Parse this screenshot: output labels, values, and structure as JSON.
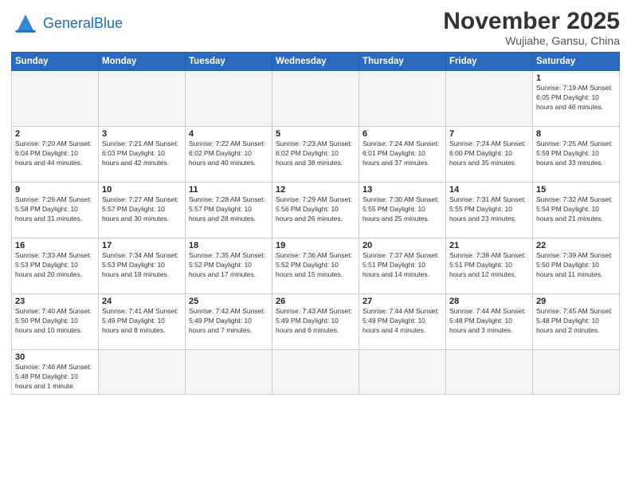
{
  "header": {
    "logo_general": "General",
    "logo_blue": "Blue",
    "month_title": "November 2025",
    "location": "Wujiahe, Gansu, China"
  },
  "weekdays": [
    "Sunday",
    "Monday",
    "Tuesday",
    "Wednesday",
    "Thursday",
    "Friday",
    "Saturday"
  ],
  "weeks": [
    [
      {
        "day": "",
        "info": "",
        "empty": true
      },
      {
        "day": "",
        "info": "",
        "empty": true
      },
      {
        "day": "",
        "info": "",
        "empty": true
      },
      {
        "day": "",
        "info": "",
        "empty": true
      },
      {
        "day": "",
        "info": "",
        "empty": true
      },
      {
        "day": "",
        "info": "",
        "empty": true
      },
      {
        "day": "1",
        "info": "Sunrise: 7:19 AM\nSunset: 6:05 PM\nDaylight: 10 hours\nand 46 minutes."
      }
    ],
    [
      {
        "day": "2",
        "info": "Sunrise: 7:20 AM\nSunset: 6:04 PM\nDaylight: 10 hours\nand 44 minutes."
      },
      {
        "day": "3",
        "info": "Sunrise: 7:21 AM\nSunset: 6:03 PM\nDaylight: 10 hours\nand 42 minutes."
      },
      {
        "day": "4",
        "info": "Sunrise: 7:22 AM\nSunset: 6:02 PM\nDaylight: 10 hours\nand 40 minutes."
      },
      {
        "day": "5",
        "info": "Sunrise: 7:23 AM\nSunset: 6:02 PM\nDaylight: 10 hours\nand 38 minutes."
      },
      {
        "day": "6",
        "info": "Sunrise: 7:24 AM\nSunset: 6:01 PM\nDaylight: 10 hours\nand 37 minutes."
      },
      {
        "day": "7",
        "info": "Sunrise: 7:24 AM\nSunset: 6:00 PM\nDaylight: 10 hours\nand 35 minutes."
      },
      {
        "day": "8",
        "info": "Sunrise: 7:25 AM\nSunset: 5:59 PM\nDaylight: 10 hours\nand 33 minutes."
      }
    ],
    [
      {
        "day": "9",
        "info": "Sunrise: 7:26 AM\nSunset: 5:58 PM\nDaylight: 10 hours\nand 31 minutes."
      },
      {
        "day": "10",
        "info": "Sunrise: 7:27 AM\nSunset: 5:57 PM\nDaylight: 10 hours\nand 30 minutes."
      },
      {
        "day": "11",
        "info": "Sunrise: 7:28 AM\nSunset: 5:57 PM\nDaylight: 10 hours\nand 28 minutes."
      },
      {
        "day": "12",
        "info": "Sunrise: 7:29 AM\nSunset: 5:56 PM\nDaylight: 10 hours\nand 26 minutes."
      },
      {
        "day": "13",
        "info": "Sunrise: 7:30 AM\nSunset: 5:55 PM\nDaylight: 10 hours\nand 25 minutes."
      },
      {
        "day": "14",
        "info": "Sunrise: 7:31 AM\nSunset: 5:55 PM\nDaylight: 10 hours\nand 23 minutes."
      },
      {
        "day": "15",
        "info": "Sunrise: 7:32 AM\nSunset: 5:54 PM\nDaylight: 10 hours\nand 21 minutes."
      }
    ],
    [
      {
        "day": "16",
        "info": "Sunrise: 7:33 AM\nSunset: 5:53 PM\nDaylight: 10 hours\nand 20 minutes."
      },
      {
        "day": "17",
        "info": "Sunrise: 7:34 AM\nSunset: 5:53 PM\nDaylight: 10 hours\nand 18 minutes."
      },
      {
        "day": "18",
        "info": "Sunrise: 7:35 AM\nSunset: 5:52 PM\nDaylight: 10 hours\nand 17 minutes."
      },
      {
        "day": "19",
        "info": "Sunrise: 7:36 AM\nSunset: 5:52 PM\nDaylight: 10 hours\nand 15 minutes."
      },
      {
        "day": "20",
        "info": "Sunrise: 7:37 AM\nSunset: 5:51 PM\nDaylight: 10 hours\nand 14 minutes."
      },
      {
        "day": "21",
        "info": "Sunrise: 7:38 AM\nSunset: 5:51 PM\nDaylight: 10 hours\nand 12 minutes."
      },
      {
        "day": "22",
        "info": "Sunrise: 7:39 AM\nSunset: 5:50 PM\nDaylight: 10 hours\nand 11 minutes."
      }
    ],
    [
      {
        "day": "23",
        "info": "Sunrise: 7:40 AM\nSunset: 5:50 PM\nDaylight: 10 hours\nand 10 minutes."
      },
      {
        "day": "24",
        "info": "Sunrise: 7:41 AM\nSunset: 5:49 PM\nDaylight: 10 hours\nand 8 minutes."
      },
      {
        "day": "25",
        "info": "Sunrise: 7:42 AM\nSunset: 5:49 PM\nDaylight: 10 hours\nand 7 minutes."
      },
      {
        "day": "26",
        "info": "Sunrise: 7:43 AM\nSunset: 5:49 PM\nDaylight: 10 hours\nand 6 minutes."
      },
      {
        "day": "27",
        "info": "Sunrise: 7:44 AM\nSunset: 5:49 PM\nDaylight: 10 hours\nand 4 minutes."
      },
      {
        "day": "28",
        "info": "Sunrise: 7:44 AM\nSunset: 5:48 PM\nDaylight: 10 hours\nand 3 minutes."
      },
      {
        "day": "29",
        "info": "Sunrise: 7:45 AM\nSunset: 5:48 PM\nDaylight: 10 hours\nand 2 minutes."
      }
    ],
    [
      {
        "day": "30",
        "info": "Sunrise: 7:46 AM\nSunset: 5:48 PM\nDaylight: 10 hours\nand 1 minute."
      },
      {
        "day": "",
        "info": "",
        "empty": true
      },
      {
        "day": "",
        "info": "",
        "empty": true
      },
      {
        "day": "",
        "info": "",
        "empty": true
      },
      {
        "day": "",
        "info": "",
        "empty": true
      },
      {
        "day": "",
        "info": "",
        "empty": true
      },
      {
        "day": "",
        "info": "",
        "empty": true
      }
    ]
  ]
}
